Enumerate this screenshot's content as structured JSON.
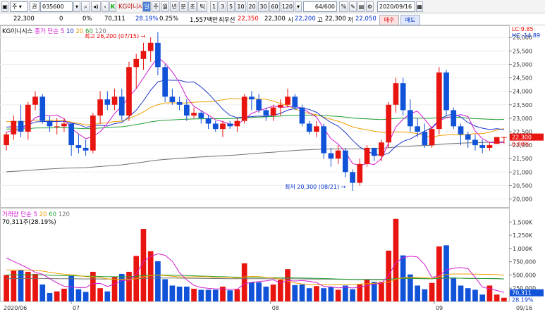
{
  "toolbar": {
    "market_label": "주",
    "type_label": "권",
    "code": "035600",
    "icon_flag": "K",
    "company": "KG이니시스",
    "w_label": "일",
    "period_buttons": [
      "주",
      "월",
      "년",
      "분",
      "초",
      "틱"
    ],
    "interval_buttons": [
      "1",
      "3",
      "5",
      "10",
      "20",
      "30",
      "60",
      "120"
    ],
    "count_value": "64",
    "count_total": "/600",
    "date_value": "2020/09/16"
  },
  "info": {
    "price": "22,300",
    "change": "0",
    "change_pct": "0%",
    "volume": "70,311",
    "vol_ratio": "28.19%",
    "turnover_pct": "0.25%",
    "trade_value": "1,557백만",
    "best_bid_label": "최우선",
    "best_bid": "22,350",
    "current": "22,300",
    "ask_label": "시",
    "ask": "22,200",
    "high_label": "고",
    "high": "22,300",
    "low_label": "저",
    "low": "22,050",
    "buy_label": "매수",
    "sell_label": "매도"
  },
  "price_panel": {
    "title": "KG이니시스",
    "ma_label": "종가 단순",
    "ma_periods": [
      "5",
      "10",
      "20",
      "60",
      "120"
    ],
    "lc_label": "LC:9.85",
    "hc_label": "HC:-14.89",
    "high_marker": "최고 26,200 (07/15)",
    "low_marker": "최저 20,300 (08/21)",
    "current_tag": "22,300",
    "current_pct": "0.00%",
    "y_labels": [
      "26,000",
      "25,500",
      "25,000",
      "24,500",
      "24,000",
      "23,500",
      "23,000",
      "22,500",
      "22,000",
      "21,500",
      "21,000",
      "20,500",
      "20,000"
    ]
  },
  "volume_panel": {
    "title": "거래량",
    "ma_label": "단순",
    "ma_periods": [
      "5",
      "20",
      "60",
      "120"
    ],
    "readout": "70,311주(28.19%)",
    "current_tag": "70,311",
    "current_pct": "28.19%",
    "y_labels": [
      "1,500K",
      "1,250K",
      "1,000K",
      "750,000",
      "500,000",
      "250,000"
    ]
  },
  "x_labels": [
    "2020/06",
    "07",
    "08",
    "09",
    "09/16"
  ],
  "colors": {
    "up": "#e8140f",
    "down": "#1052d8",
    "ma5": "#d21cd2",
    "ma10": "#2035c8",
    "ma20": "#f0a000",
    "ma60": "#20a030",
    "ma120": "#707070"
  },
  "chart_data": {
    "type": "candlestick",
    "candles": [
      [
        22000,
        22500,
        21800,
        22400
      ],
      [
        22400,
        23100,
        22200,
        22900
      ],
      [
        22900,
        23500,
        22300,
        22500
      ],
      [
        22500,
        23600,
        22200,
        23500
      ],
      [
        23500,
        24000,
        23300,
        23800
      ],
      [
        23800,
        23900,
        22800,
        22900
      ],
      [
        22900,
        23100,
        22500,
        22700
      ],
      [
        22700,
        23000,
        22400,
        22700
      ],
      [
        22700,
        23000,
        22500,
        22800
      ],
      [
        22800,
        22800,
        21600,
        22000
      ],
      [
        22000,
        22400,
        21700,
        21900
      ],
      [
        21900,
        22200,
        21600,
        21800
      ],
      [
        21800,
        23200,
        21700,
        23100
      ],
      [
        23100,
        24000,
        22800,
        23700
      ],
      [
        23700,
        24000,
        23300,
        23500
      ],
      [
        23500,
        24100,
        23300,
        23800
      ],
      [
        23800,
        24100,
        22900,
        23100
      ],
      [
        23100,
        25100,
        22900,
        24900
      ],
      [
        24900,
        25400,
        24100,
        25200
      ],
      [
        25200,
        25800,
        24800,
        25500
      ],
      [
        25500,
        26000,
        25100,
        25800
      ],
      [
        25800,
        26200,
        24600,
        24900
      ],
      [
        24900,
        25000,
        23600,
        23800
      ],
      [
        23800,
        24100,
        23500,
        23600
      ],
      [
        23600,
        23800,
        23300,
        23500
      ],
      [
        23500,
        23700,
        22900,
        23100
      ],
      [
        23100,
        23400,
        23000,
        23200
      ],
      [
        23200,
        23300,
        22800,
        23000
      ],
      [
        23000,
        23100,
        22600,
        22800
      ],
      [
        22800,
        22900,
        22500,
        22600
      ],
      [
        22600,
        22900,
        22300,
        22800
      ],
      [
        22800,
        22900,
        22600,
        22700
      ],
      [
        22700,
        23000,
        22500,
        22900
      ],
      [
        22900,
        23900,
        22800,
        23800
      ],
      [
        23800,
        24000,
        23300,
        23700
      ],
      [
        23700,
        23900,
        23200,
        23300
      ],
      [
        23300,
        23400,
        22900,
        23100
      ],
      [
        23100,
        23500,
        22900,
        23400
      ],
      [
        23400,
        23700,
        23100,
        23500
      ],
      [
        23500,
        24100,
        23400,
        23800
      ],
      [
        23800,
        23900,
        23300,
        23400
      ],
      [
        23400,
        23500,
        22700,
        22800
      ],
      [
        22800,
        22900,
        22400,
        22500
      ],
      [
        22500,
        22900,
        22300,
        22700
      ],
      [
        22700,
        22800,
        21500,
        21700
      ],
      [
        21700,
        21900,
        21200,
        21500
      ],
      [
        21500,
        22000,
        21300,
        21800
      ],
      [
        21800,
        21900,
        20800,
        21000
      ],
      [
        21000,
        21100,
        20300,
        20600
      ],
      [
        20600,
        21500,
        20500,
        21300
      ],
      [
        21300,
        22000,
        21200,
        21900
      ],
      [
        21900,
        21900,
        21400,
        21600
      ],
      [
        21600,
        22200,
        21400,
        22100
      ],
      [
        22100,
        23600,
        21900,
        23500
      ],
      [
        23500,
        24500,
        23200,
        24300
      ],
      [
        24300,
        24500,
        23100,
        23300
      ],
      [
        23300,
        23700,
        22500,
        22700
      ],
      [
        22700,
        23000,
        22300,
        22500
      ],
      [
        22500,
        22800,
        21900,
        22000
      ],
      [
        22000,
        22700,
        21900,
        22600
      ],
      [
        22600,
        24900,
        22400,
        24700
      ],
      [
        24700,
        24800,
        23100,
        23300
      ],
      [
        23300,
        23400,
        22600,
        22700
      ],
      [
        22700,
        22800,
        22000,
        22400
      ],
      [
        22400,
        22500,
        21900,
        22200
      ],
      [
        22200,
        22400,
        21800,
        22000
      ],
      [
        22000,
        22200,
        21700,
        21900
      ],
      [
        21900,
        22100,
        21800,
        22000
      ],
      [
        22050,
        22300,
        22050,
        22300
      ],
      [
        22300,
        22300,
        22050,
        22300
      ]
    ],
    "volumes": [
      500,
      580,
      590,
      560,
      520,
      320,
      160,
      190,
      240,
      480,
      230,
      180,
      560,
      250,
      190,
      460,
      520,
      560,
      860,
      1370,
      950,
      760,
      420,
      300,
      280,
      280,
      240,
      220,
      220,
      220,
      280,
      210,
      230,
      720,
      360,
      360,
      280,
      320,
      410,
      610,
      310,
      320,
      250,
      290,
      250,
      270,
      220,
      300,
      230,
      320,
      420,
      370,
      370,
      960,
      1560,
      870,
      510,
      300,
      230,
      350,
      1040,
      1060,
      450,
      300,
      250,
      220,
      130,
      300,
      130,
      70
    ]
  }
}
